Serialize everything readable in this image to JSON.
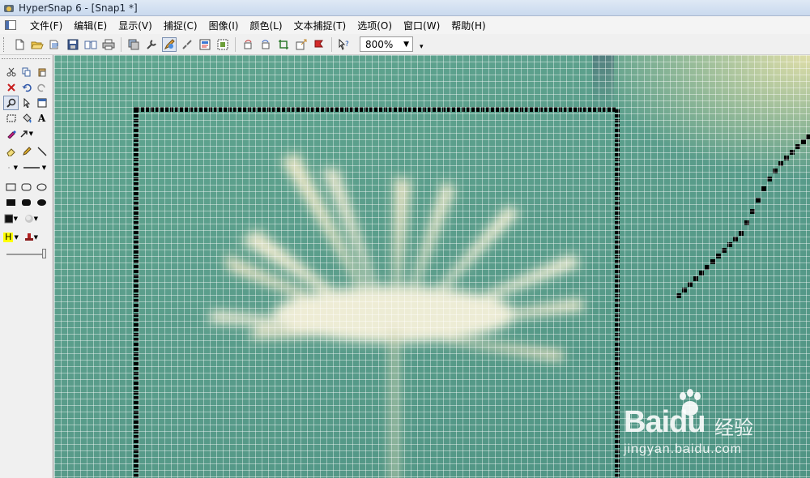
{
  "window": {
    "title": "HyperSnap 6 - [Snap1 *]"
  },
  "menu": {
    "items": [
      "文件(F)",
      "编辑(E)",
      "显示(V)",
      "捕捉(C)",
      "图像(I)",
      "颜色(L)",
      "文本捕捉(T)",
      "选项(O)",
      "窗口(W)",
      "帮助(H)"
    ]
  },
  "toolbar": {
    "buttons": [
      "new-icon",
      "open-icon",
      "open-folder-icon",
      "save-icon",
      "page-view-icon",
      "print-icon",
      "copy-image-icon",
      "tools-icon",
      "edit-icon",
      "brush-icon",
      "capture-screen-icon",
      "capture-region-icon",
      "rotate-left-icon",
      "rotate-right-icon",
      "crop-icon",
      "resize-icon",
      "stamp-icon",
      "help-pointer-icon"
    ],
    "zoom": {
      "value": "800%"
    }
  },
  "toolbox": {
    "rows": [
      [
        "cut-icon",
        "copy-icon",
        "paste-icon"
      ],
      [
        "delete-icon",
        "undo-icon",
        "redo-icon"
      ],
      [
        "zoom-icon",
        "pointer-icon",
        "select-window-icon"
      ],
      [
        "rect-select-icon",
        "fill-icon",
        "text-icon"
      ],
      [
        "color-picker-icon",
        "arrow-icon"
      ],
      [
        "eraser-icon",
        "pencil-icon",
        "line-icon"
      ],
      [
        "dot-icon",
        "line-style-icon"
      ],
      [
        "rectangle-icon",
        "rounded-rect-icon",
        "ellipse-icon"
      ],
      [
        "filled-rect-icon",
        "filled-rounded-icon",
        "filled-ellipse-icon"
      ],
      [
        "fill-color-icon",
        "shadow-icon"
      ],
      [
        "highlight-icon",
        "stamp-tool-icon"
      ]
    ],
    "highlight_label": "H"
  },
  "canvas": {
    "zoom_level": "800%",
    "colors": {
      "background": "#5a9d8b",
      "flower": "#f3eccd",
      "frame": "#000000"
    }
  },
  "watermark": {
    "brand": "Bai",
    "brand_suffix": "du",
    "cn": "经验",
    "url": "jingyan.baidu.com"
  }
}
